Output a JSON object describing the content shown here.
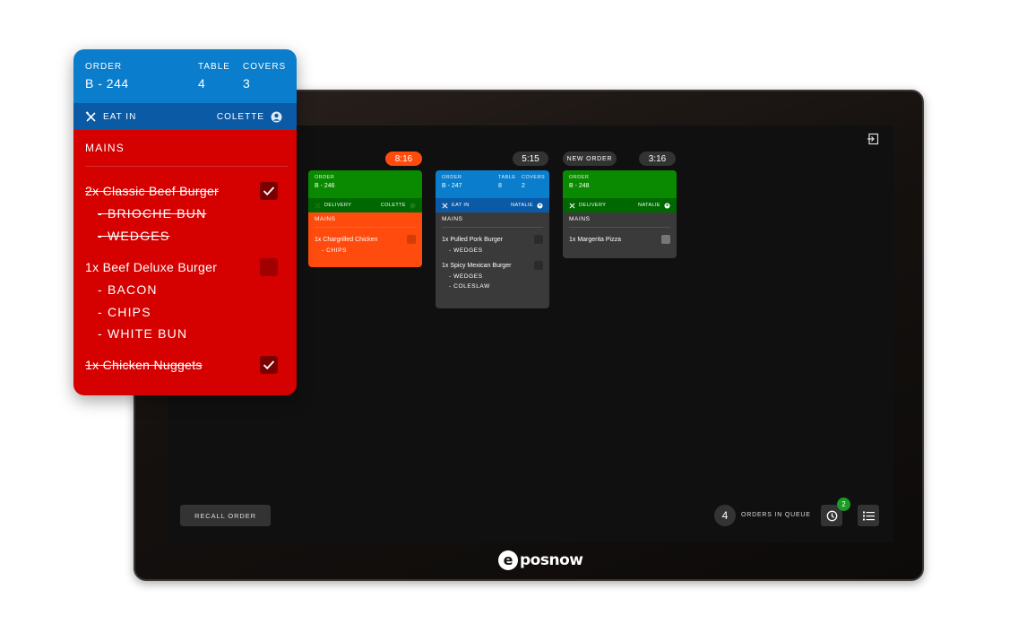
{
  "screen": {
    "recall_label": "RECALL ORDER",
    "queue_count": "4",
    "queue_label": "ORDERS IN QUEUE",
    "badge_count": "2",
    "logo_e": "e",
    "logo_text": "posnow"
  },
  "pills": {
    "p1": "8:16",
    "p2": "5:15",
    "p3_label": "NEW ORDER",
    "p3": "3:16"
  },
  "orders": [
    {
      "order_label": "ORDER",
      "order": "B - 246",
      "type": "DELIVERY",
      "staff": "COLETTE",
      "section": "MAINS",
      "items": [
        {
          "name": "1x Chargrilled Chicken",
          "mods": [
            "- CHIPS"
          ]
        }
      ]
    },
    {
      "order_label": "ORDER",
      "order": "B - 247",
      "table_label": "TABLE",
      "table": "8",
      "covers_label": "COVERS",
      "covers": "2",
      "type": "EAT IN",
      "staff": "NATALIE",
      "section": "MAINS",
      "items": [
        {
          "name": "1x Pulled Pork Burger",
          "mods": [
            "- WEDGES"
          ]
        },
        {
          "name": "1x Spicy Mexican Burger",
          "mods": [
            "- WEDGES",
            "- COLESLAW"
          ]
        }
      ]
    },
    {
      "order_label": "ORDER",
      "order": "B - 248",
      "type": "DELIVERY",
      "staff": "NATALIE",
      "section": "MAINS",
      "items": [
        {
          "name": "1x Margerita Pizza",
          "mods": []
        }
      ]
    }
  ],
  "big_card": {
    "order_label": "ORDER",
    "order": "B - 244",
    "table_label": "TABLE",
    "table": "4",
    "covers_label": "COVERS",
    "covers": "3",
    "type": "EAT IN",
    "staff": "COLETTE",
    "section": "MAINS",
    "items": [
      {
        "name": "2x Classic Beef Burger",
        "done": true,
        "mods": [
          "- BRIOCHE BUN",
          "- WEDGES"
        ]
      },
      {
        "name": "1x Beef Deluxe Burger",
        "done": false,
        "mods": [
          "- BACON",
          "- CHIPS",
          "- WHITE BUN"
        ]
      },
      {
        "name": "1x Chicken Nuggets",
        "done": true,
        "mods": []
      }
    ]
  },
  "colors": {
    "delivery_green": "#0a8a00",
    "eat_in_blue": "#0a7dcc",
    "late_orange": "#ff4b0d",
    "urgent_red": "#d50000",
    "card_grey": "#3a3a3a"
  },
  "icons": [
    "cutlery-icon",
    "user-circle-icon",
    "check-icon",
    "exit-icon",
    "clock-icon",
    "list-icon"
  ]
}
